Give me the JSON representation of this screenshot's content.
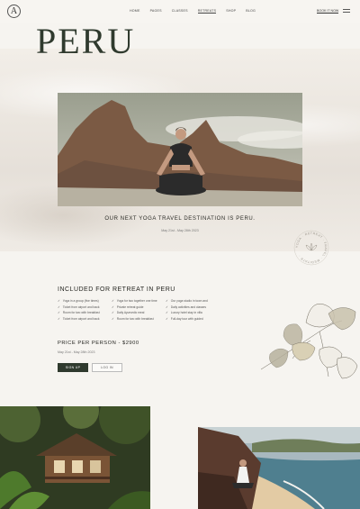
{
  "nav": {
    "logo_letter": "A",
    "links": [
      "HOME",
      "PAGES",
      "CLASSES",
      "RETREATS",
      "SHOP",
      "BLOG"
    ],
    "active_index": 3,
    "cta": "BOOK IT NOW"
  },
  "hero": {
    "title": "PERU",
    "tagline": "OUR NEXT YOGA TRAVEL DESTINATION IS PERU.",
    "dates": "May 21st - May 28th 2023"
  },
  "badge": {
    "text": "YOGA · RETREAT · TRAVEL · MEDITATE ·"
  },
  "included": {
    "heading": "INCLUDED FOR RETREAT IN PERU",
    "col1": [
      "Yoga in a group (five times)",
      "Ticket from airport and back",
      "Room for two with breakfast",
      "Ticket from airport and back"
    ],
    "col2": [
      "Yoga for two together one time",
      "Private retreat guide",
      "Daily Ayurvedic meal",
      "Room for two with breakfast"
    ],
    "col3": [
      "Our yoga studio in town and",
      "Daily activities and classes",
      "Luxury hotel stay in villa",
      "Full-day tour with guided"
    ]
  },
  "pricing": {
    "price_label": "PRICE PER PERSON - $2900",
    "dates": "May 21st - May 28th 2023",
    "signup": "SIGN UP",
    "login": "LOG IN"
  },
  "colors": {
    "accent": "#2f3a2e",
    "background": "#f6f4f0"
  }
}
